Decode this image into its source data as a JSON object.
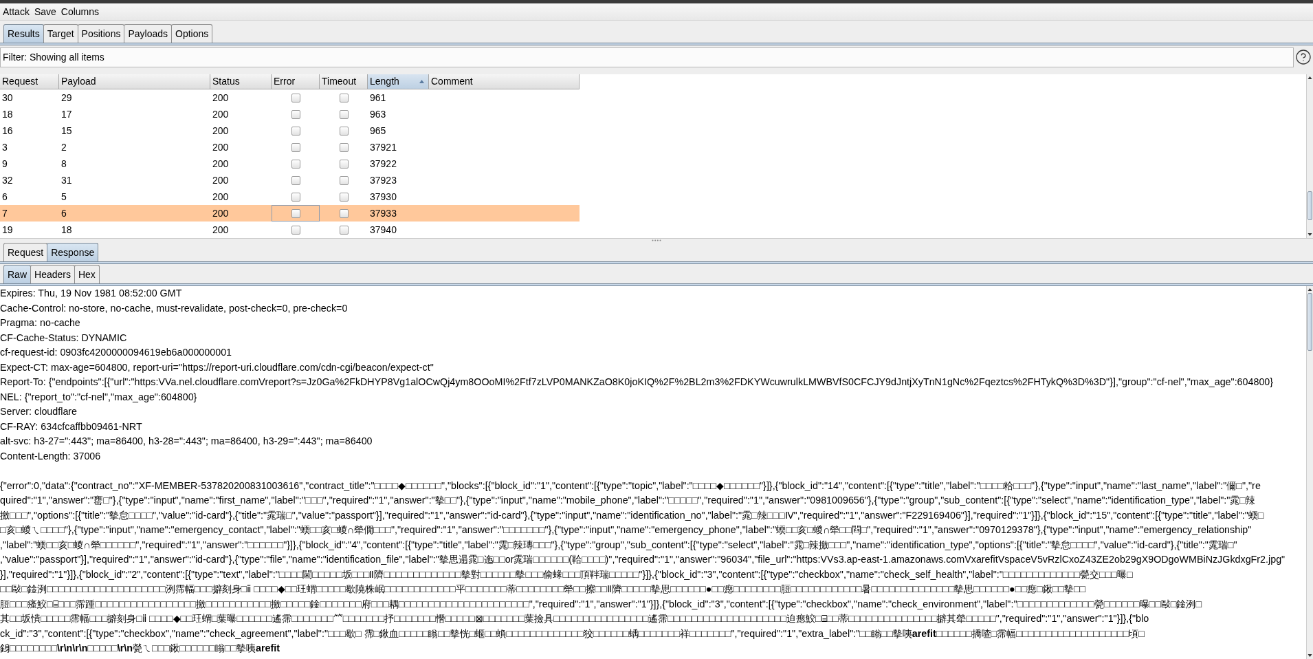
{
  "menu": [
    {
      "label": "Attack"
    },
    {
      "label": "Save"
    },
    {
      "label": "Columns"
    }
  ],
  "tabs": [
    {
      "label": "Results",
      "selected": true
    },
    {
      "label": "Target",
      "selected": false
    },
    {
      "label": "Positions",
      "selected": false
    },
    {
      "label": "Payloads",
      "selected": false
    },
    {
      "label": "Options",
      "selected": false
    }
  ],
  "filter": {
    "label": "Filter: Showing all items"
  },
  "table": {
    "columns": [
      {
        "label": "Request",
        "sorted": false
      },
      {
        "label": "Payload",
        "sorted": false
      },
      {
        "label": "Status",
        "sorted": false
      },
      {
        "label": "Error",
        "sorted": false
      },
      {
        "label": "Timeout",
        "sorted": false
      },
      {
        "label": "Length",
        "sorted": true
      },
      {
        "label": "Comment",
        "sorted": false
      }
    ],
    "rows": [
      {
        "request": "30",
        "payload": "29",
        "status": "200",
        "error": false,
        "timeout": false,
        "length": "961",
        "selected": false,
        "error_focused": false
      },
      {
        "request": "18",
        "payload": "17",
        "status": "200",
        "error": false,
        "timeout": false,
        "length": "963",
        "selected": false,
        "error_focused": false
      },
      {
        "request": "16",
        "payload": "15",
        "status": "200",
        "error": false,
        "timeout": false,
        "length": "965",
        "selected": false,
        "error_focused": false
      },
      {
        "request": "3",
        "payload": "2",
        "status": "200",
        "error": false,
        "timeout": false,
        "length": "37921",
        "selected": false,
        "error_focused": false
      },
      {
        "request": "9",
        "payload": "8",
        "status": "200",
        "error": false,
        "timeout": false,
        "length": "37922",
        "selected": false,
        "error_focused": false
      },
      {
        "request": "32",
        "payload": "31",
        "status": "200",
        "error": false,
        "timeout": false,
        "length": "37923",
        "selected": false,
        "error_focused": false
      },
      {
        "request": "6",
        "payload": "5",
        "status": "200",
        "error": false,
        "timeout": false,
        "length": "37930",
        "selected": false,
        "error_focused": false
      },
      {
        "request": "7",
        "payload": "6",
        "status": "200",
        "error": false,
        "timeout": false,
        "length": "37933",
        "selected": true,
        "error_focused": true
      },
      {
        "request": "19",
        "payload": "18",
        "status": "200",
        "error": false,
        "timeout": false,
        "length": "37940",
        "selected": false,
        "error_focused": false
      }
    ]
  },
  "message_tabs": [
    {
      "label": "Request",
      "selected": false
    },
    {
      "label": "Response",
      "selected": true
    }
  ],
  "view_tabs": [
    {
      "label": "Raw",
      "selected": true
    },
    {
      "label": "Headers",
      "selected": false
    },
    {
      "label": "Hex",
      "selected": false
    }
  ],
  "response": {
    "headers": [
      "Expires: Thu, 19 Nov 1981 08:52:00 GMT",
      "Cache-Control: no-store, no-cache, must-revalidate, post-check=0, pre-check=0",
      "Pragma: no-cache",
      "CF-Cache-Status: DYNAMIC",
      "cf-request-id: 0903fc4200000094619eb6a000000001",
      "Expect-CT: max-age=604800, report-uri=\"https://report-uri.cloudflare.com/cdn-cgi/beacon/expect-ct\"",
      "Report-To: {\"endpoints\":[{\"url\":\"https:VVa.nel.cloudflare.comVreport?s=Jz0Ga%2FkDHYP8Vg1alOCwQj4ym8OOoMI%2Ftf7zLVP0MANKZaO8K0joKIQ%2F%2BL2m3%2FDKYWcuwrulkLMWBVfS0CFCJY9dJntjXyTnN1gNc%2Fqeztcs%2FHTykQ%3D%3D\"}],\"group\":\"cf-nel\",\"max_age\":604800}",
      "NEL: {\"report_to\":\"cf-nel\",\"max_age\":604800}",
      "Server: cloudflare",
      "CF-RAY: 634cfcaffbb09461-NRT",
      "alt-svc: h3-27=\":443\"; ma=86400, h3-28=\":443\"; ma=86400, h3-29=\":443\"; ma=86400",
      "Content-Length: 37006"
    ],
    "body_lines": [
      "{\"error\":0,\"data\":{\"contract_no\":\"XF-MEMBER-537820200831003616\",\"contract_title\":\"□□□□◆□□□□□□\",\"blocks\":[{\"block_id\":\"1\",\"content\":[{\"type\":\"topic\",\"label\":\"□□□□◆□□□□□□\"}]},{\"block_id\":\"14\",\"content\":[{\"type\":\"title\",\"label\":\"□□□□粭□□□\"},{\"type\":\"input\",\"name\":\"last_name\",\"label\":\"儞□\",\"re",
      "quired\":\"1\",\"answer\":\"罋□\"},{\"type\":\"input\",\"name\":\"first_name\",\"label\":\"□□□\",\"required\":\"1\",\"answer\":\"摰□□\"},{\"type\":\"input\",\"name\":\"mobile_phone\",\"label\":\"□□□□□\",\"required\":\"1\",\"answer\":\"0981009656\"},{\"type\":\"group\",\"sub_content\":[{\"type\":\"select\",\"name\":\"identification_type\",\"label\":\"雿□辣",
      "撽□□□\",\"options\":[{\"title\":\"摰怠□□□□\",\"value\":\"id-card\"},{\"title\":\"雿瑞□\",\"value\":\"passport\"}],\"required\":\"1\",\"answer\":\"id-card\"},{\"type\":\"input\",\"name\":\"identification_no\",\"label\":\"雿□辣□□□Ⅳ\",\"required\":\"1\",\"answer\":\"F229169406\"}],\"required\":\"1\"}]},{\"block_id\":\"15\",\"content\":[{\"type\":\"title\",\"label\":\"蝡□",
      "□亥□蝬ㄟ□□□□\"},{\"type\":\"input\",\"name\":\"emergency_contact\",\"label\":\"蝡□□亥□蝬∩犖僩□□□\",\"required\":\"1\",\"answer\":\"□□□□□□□\"},{\"type\":\"input\",\"name\":\"emergency_phone\",\"label\":\"蝡□□亥□蝬∩犖□□閰□\",\"required\":\"1\",\"answer\":\"0970129378\"},{\"type\":\"input\",\"name\":\"emergency_relationship\"",
      ",\"label\":\"蝡□□亥□蝬∩犖□□□□□□\",\"required\":\"1\",\"answer\":\"□□□□□□\"}]},{\"block_id\":\"4\",\"content\":[{\"type\":\"title\",\"label\":\"雿□辣瑼□□□\"},{\"type\":\"group\",\"sub_content\":[{\"type\":\"select\",\"label\":\"雿□辣撽□□□\",\"name\":\"identification_type\",\"options\":[{\"title\":\"摰怠□□□□\",\"value\":\"id-card\"},{\"title\":\"雿瑞□\"",
      ",\"value\":\"passport\"}],\"required\":\"1\",\"answer\":\"id-card\"},{\"type\":\"file\",\"name\":\"identification_file\",\"label\":\"摰思遢雿□迤□□or雿瑞□□□□□□(鞈□□□□)\",\"required\":\"1\",\"answer\":\"96034\",\"file_url\":\"https:VVs3.ap-east-1.amazonaws.comVxarefitVspaceV5vRzlCxoZ43ZE2ob29gX9ODgoWMBiNzJGkdxgFr2.jpg\"",
      "}],\"required\":\"1\"}]},{\"block_id\":\"2\",\"content\":[{\"type\":\"text\",\"label\":\"□□□□閫□□□□□坂□□□Ⅱ隮□□□□□□□□□□□□□摰對□□□□□□摰□□□偷蝝□□□頂靽瑞□□□□□\"}]},{\"block_id\":\"3\",\"content\":[{\"type\":\"checkbox\",\"name\":\"check_self_health\",\"label\":\"□□□□□□□□□□□□□甇交□□□曝□",
      "□□敺□鍂洌□□□□□□□□□□□□□□□□□□□□洌霈幅□□□擗刻身□ⅱ □□□□◆□□玨蝟□□□□□歇隢株岷□□□□□□□□□□□□平□□□□□□□蒂□□□□□□□□犖□□擦□□Ⅱ隮□□□□□摰思□□□□□□●□□瘛□□□□□□□□脰□□□□□□□□□□□□暑□□□□□□□□□□□□□□摰思□□□□□□●□□瘛□鍬□□摰□□",
      "脰□□□瘙鮫□⌸□□□霈踵□□□□□□□□□□□□□□□□□撽□□□□□□□□□□□撽□□□□□鍂□□□□□□□府□□□耦□□□□□□□□□□□□□□□□□□□□□□\",\"required\":\"1\",\"answer\":\"1\"}]},{\"block_id\":\"3\",\"content\":[{\"type\":\"checkbox\",\"name\":\"check_environment\",\"label\":\"□□□□□□□□□□□□□甇□□□□□□曝□□敺□鍂洌□",
      "其□□坂憒□□□□□霈幅□□□擗刻身□ⅱ □□□□◆□□玨蝟□葉曝□□□□□□遙霈□□□□□□□⺮□□□□□□□抒□□□□□□□憯□□□□□⊠□□□□□□□葉撿具□□□□□□□□□□□□□□□□遙霈□□□□□□□□□□□□□□□□□□□□迫瘛鮫□⌸□□蒂□□□□□□□□□□□□□□□擗其犖□□□□□\",\"required\":\"1\",\"answer\":\"1\"}]},{\"blo",
      "ck_id\":\"3\",\"content\":[{\"type\":\"checkbox\",\"name\":\"check_agreement\",\"label\":\"□□□歇□ 霈□鍬血□□□□□瞈□□摰恍□蝘□□蝜□□□□□□□□□□□□□狡□□□□□□蝺□□□□□□□祥□□□□□□□\",\"required\":\"1\",\"extra_label\":\"□□瞈□□摰咦**arefit**□□□□□□撟喳□霈幅□□□□□□□□□□□□□□□□□□□頃□",
      "銵□□□□□□□□**\\r\\n\\r\\n**□□□□□**\\r\\n**甇ㄟ□□□鍬□□□□□□瞈□□摰咦**arefit**"
    ]
  }
}
